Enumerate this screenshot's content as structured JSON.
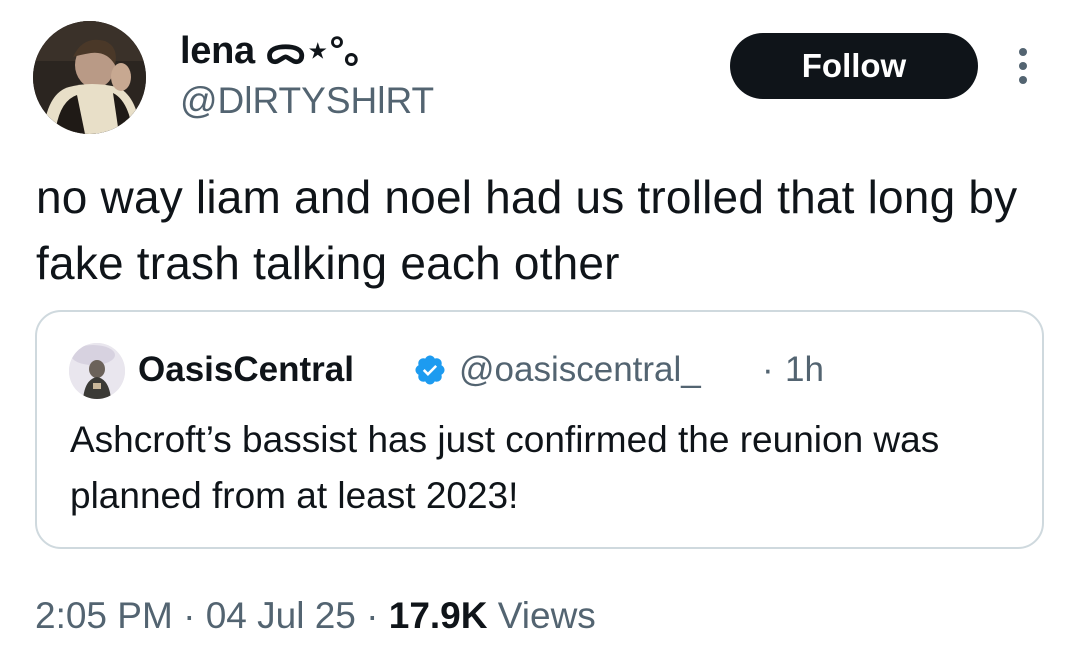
{
  "author": {
    "display_name": "lena ᯅ⋆°｡",
    "handle": "@DlRTYSHlRT",
    "avatar_icon": "profile-photo-avatar"
  },
  "actions": {
    "follow_label": "Follow",
    "more_icon": "more-vertical-icon"
  },
  "tweet": {
    "text": "no way liam and noel had us trolled that long by fake trash talking each other"
  },
  "quote": {
    "display_name": "OasisCentral",
    "verified_icon": "verified-badge-icon",
    "verified_color": "#1d9bf0",
    "handle": "@oasiscentral_",
    "separator": "·",
    "time": "1h",
    "text": "Ashcroft’s bassist has just confirmed the reunion was planned from at least 2023!"
  },
  "meta": {
    "time": "2:05 PM",
    "sep1": " · ",
    "date": "04 Jul 25",
    "sep2": " · ",
    "views_count": "17.9K",
    "views_label": " Views"
  },
  "colors": {
    "text_primary": "#0f1419",
    "text_secondary": "#536471",
    "follow_bg": "#0f1419",
    "border": "#cfd9de"
  }
}
